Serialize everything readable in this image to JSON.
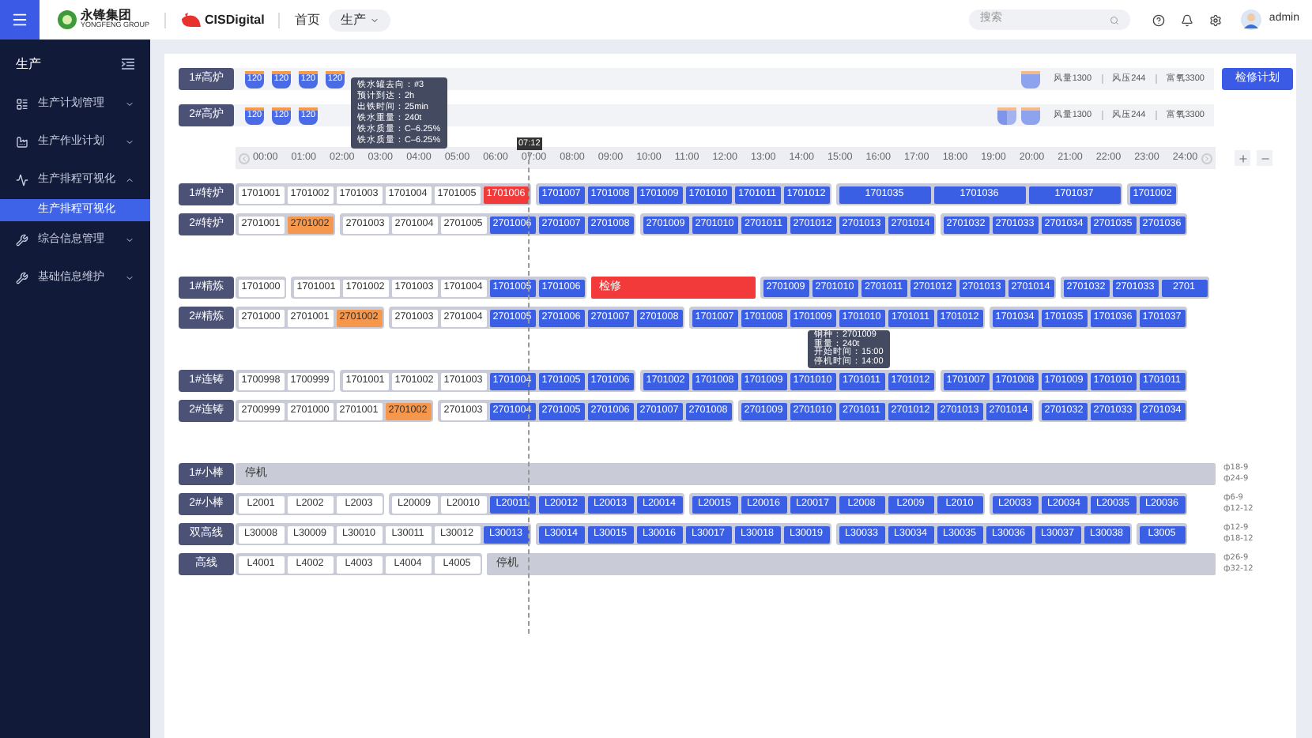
{
  "header": {
    "logo_text": "永锋集团",
    "logo_subtext": "YONGFENG GROUP",
    "brand": "CISDigital",
    "nav": [
      {
        "label": "首页",
        "kind": "link",
        "selected": false
      },
      {
        "label": "生产",
        "kind": "dropdown",
        "selected": true
      }
    ],
    "search": {
      "placeholder": "搜索"
    },
    "user": "admin"
  },
  "sidebar": {
    "title": "生产",
    "items": [
      {
        "label": "生产计划管理",
        "expanded": false
      },
      {
        "label": "生产作业计划",
        "expanded": false
      },
      {
        "label": "生产排程可视化",
        "expanded": true,
        "children": [
          {
            "label": "生产排程可视化",
            "selected": true
          }
        ]
      },
      {
        "label": "综合信息管理",
        "expanded": false
      },
      {
        "label": "基础信息维护",
        "expanded": false
      }
    ]
  },
  "furnaces": [
    {
      "label": "1#高炉",
      "ladles": [
        "120",
        "120",
        "120",
        "120"
      ],
      "spare_ladles": [
        {
          "kind": "full"
        }
      ],
      "stats": [
        "风量1300",
        "风压244",
        "富氧3300"
      ]
    },
    {
      "label": "2#高炉",
      "ladles": [
        "120",
        "120",
        "120"
      ],
      "spare_ladles": [
        {
          "kind": "half"
        },
        {
          "kind": "full"
        }
      ],
      "stats": [
        "风量1300",
        "风压244",
        "富氧3300"
      ]
    }
  ],
  "plan_button": "检修计划",
  "timeline": {
    "now": "07:12",
    "ticks": [
      "00:00",
      "01:00",
      "02:00",
      "03:00",
      "04:00",
      "05:00",
      "06:00",
      "07:00",
      "08:00",
      "09:00",
      "10:00",
      "11:00",
      "12:00",
      "13:00",
      "14:00",
      "15:00",
      "16:00",
      "17:00",
      "18:00",
      "19:00",
      "20:00",
      "21:00",
      "22:00",
      "23:00",
      "24:00"
    ]
  },
  "sections": [
    {
      "rows": [
        {
          "label": "1#转炉",
          "blocks": [
            {
              "kind": "group",
              "cells": [
                {
                  "text": "1701001",
                  "kind": "done"
                },
                {
                  "text": "1701002",
                  "kind": "done"
                },
                {
                  "text": "1701003",
                  "kind": "done"
                },
                {
                  "text": "1701004",
                  "kind": "done"
                },
                {
                  "text": "1701005",
                  "kind": "done"
                },
                {
                  "text": "1701006",
                  "kind": "alert"
                }
              ]
            },
            {
              "kind": "group",
              "cells": [
                {
                  "text": "1701007",
                  "kind": "active"
                },
                {
                  "text": "1701008",
                  "kind": "active"
                },
                {
                  "text": "1701009",
                  "kind": "active"
                },
                {
                  "text": "1701010",
                  "kind": "active"
                },
                {
                  "text": "1701011",
                  "kind": "active"
                },
                {
                  "text": "1701012",
                  "kind": "active"
                }
              ]
            },
            {
              "kind": "group",
              "cells": [
                {
                  "text": "1701035",
                  "kind": "wide"
                },
                {
                  "text": "1701036",
                  "kind": "wide"
                },
                {
                  "text": "1701037",
                  "kind": "wide"
                }
              ]
            },
            {
              "kind": "group",
              "cells": [
                {
                  "text": "1701002",
                  "kind": "active"
                }
              ]
            }
          ]
        },
        {
          "label": "2#转炉",
          "blocks": [
            {
              "kind": "group",
              "cells": [
                {
                  "text": "2701001",
                  "kind": "done"
                },
                {
                  "text": "2701002",
                  "kind": "delayed"
                }
              ]
            },
            {
              "kind": "group",
              "cells": [
                {
                  "text": "2701003",
                  "kind": "done"
                },
                {
                  "text": "2701004",
                  "kind": "done"
                },
                {
                  "text": "2701005",
                  "kind": "done"
                },
                {
                  "text": "2701006",
                  "kind": "active"
                },
                {
                  "text": "2701007",
                  "kind": "active"
                },
                {
                  "text": "2701008",
                  "kind": "active"
                }
              ]
            },
            {
              "kind": "group",
              "cells": [
                {
                  "text": "2701009",
                  "kind": "active"
                },
                {
                  "text": "2701010",
                  "kind": "active"
                },
                {
                  "text": "2701011",
                  "kind": "active"
                },
                {
                  "text": "2701012",
                  "kind": "active"
                },
                {
                  "text": "2701013",
                  "kind": "active"
                },
                {
                  "text": "2701014",
                  "kind": "active"
                }
              ]
            },
            {
              "kind": "group",
              "cells": [
                {
                  "text": "2701032",
                  "kind": "active"
                },
                {
                  "text": "2701033",
                  "kind": "active"
                },
                {
                  "text": "2701034",
                  "kind": "active"
                },
                {
                  "text": "2701035",
                  "kind": "active"
                },
                {
                  "text": "2701036",
                  "kind": "active"
                }
              ]
            }
          ]
        }
      ]
    },
    {
      "rows": [
        {
          "label": "1#精炼",
          "blocks": [
            {
              "kind": "group",
              "cells": [
                {
                  "text": "1701000",
                  "kind": "done"
                }
              ]
            },
            {
              "kind": "group",
              "cells": [
                {
                  "text": "1701001",
                  "kind": "done"
                },
                {
                  "text": "1701002",
                  "kind": "done"
                },
                {
                  "text": "1701003",
                  "kind": "done"
                },
                {
                  "text": "1701004",
                  "kind": "done"
                },
                {
                  "text": "1701005",
                  "kind": "active"
                },
                {
                  "text": "1701006",
                  "kind": "active"
                }
              ]
            },
            {
              "kind": "maintenance",
              "text": "检修"
            },
            {
              "kind": "group",
              "cells": [
                {
                  "text": "2701009",
                  "kind": "active"
                },
                {
                  "text": "2701010",
                  "kind": "active"
                },
                {
                  "text": "2701011",
                  "kind": "active"
                },
                {
                  "text": "2701012",
                  "kind": "active"
                },
                {
                  "text": "2701013",
                  "kind": "active"
                },
                {
                  "text": "2701014",
                  "kind": "active"
                }
              ]
            },
            {
              "kind": "group",
              "cells": [
                {
                  "text": "2701032",
                  "kind": "active"
                },
                {
                  "text": "2701033",
                  "kind": "active"
                },
                {
                  "text": "2701",
                  "kind": "active"
                }
              ]
            }
          ]
        },
        {
          "label": "2#精炼",
          "blocks": [
            {
              "kind": "group",
              "cells": [
                {
                  "text": "2701000",
                  "kind": "done"
                },
                {
                  "text": "2701001",
                  "kind": "done"
                },
                {
                  "text": "2701002",
                  "kind": "delayed"
                }
              ]
            },
            {
              "kind": "group",
              "cells": [
                {
                  "text": "2701003",
                  "kind": "done"
                },
                {
                  "text": "2701004",
                  "kind": "done"
                },
                {
                  "text": "2701005",
                  "kind": "active"
                },
                {
                  "text": "2701006",
                  "kind": "active"
                },
                {
                  "text": "2701007",
                  "kind": "active"
                },
                {
                  "text": "2701008",
                  "kind": "active"
                }
              ]
            },
            {
              "kind": "group",
              "cells": [
                {
                  "text": "1701007",
                  "kind": "active"
                },
                {
                  "text": "1701008",
                  "kind": "active"
                },
                {
                  "text": "1701009",
                  "kind": "active"
                },
                {
                  "text": "1701010",
                  "kind": "active"
                },
                {
                  "text": "1701011",
                  "kind": "active"
                },
                {
                  "text": "1701012",
                  "kind": "active"
                }
              ]
            },
            {
              "kind": "group",
              "cells": [
                {
                  "text": "1701034",
                  "kind": "active"
                },
                {
                  "text": "1701035",
                  "kind": "active"
                },
                {
                  "text": "1701036",
                  "kind": "active"
                },
                {
                  "text": "1701037",
                  "kind": "active"
                }
              ]
            }
          ]
        }
      ]
    },
    {
      "rows": [
        {
          "label": "1#连铸",
          "blocks": [
            {
              "kind": "group",
              "cells": [
                {
                  "text": "1700998",
                  "kind": "done"
                },
                {
                  "text": "1700999",
                  "kind": "done"
                }
              ]
            },
            {
              "kind": "group",
              "cells": [
                {
                  "text": "1701001",
                  "kind": "done"
                },
                {
                  "text": "1701002",
                  "kind": "done"
                },
                {
                  "text": "1701003",
                  "kind": "done"
                },
                {
                  "text": "1701004",
                  "kind": "active"
                },
                {
                  "text": "1701005",
                  "kind": "active"
                },
                {
                  "text": "1701006",
                  "kind": "active"
                }
              ]
            },
            {
              "kind": "group",
              "cells": [
                {
                  "text": "1701002",
                  "kind": "active"
                },
                {
                  "text": "1701008",
                  "kind": "active"
                },
                {
                  "text": "1701009",
                  "kind": "active"
                },
                {
                  "text": "1701010",
                  "kind": "active"
                },
                {
                  "text": "1701011",
                  "kind": "active"
                },
                {
                  "text": "1701012",
                  "kind": "active"
                }
              ]
            },
            {
              "kind": "group",
              "cells": [
                {
                  "text": "1701007",
                  "kind": "active"
                },
                {
                  "text": "1701008",
                  "kind": "active"
                },
                {
                  "text": "1701009",
                  "kind": "active"
                },
                {
                  "text": "1701010",
                  "kind": "active"
                },
                {
                  "text": "1701011",
                  "kind": "active"
                }
              ]
            }
          ]
        },
        {
          "label": "2#连铸",
          "blocks": [
            {
              "kind": "group",
              "cells": [
                {
                  "text": "2700999",
                  "kind": "done"
                },
                {
                  "text": "2701000",
                  "kind": "done"
                },
                {
                  "text": "2701001",
                  "kind": "done"
                },
                {
                  "text": "2701002",
                  "kind": "delayed"
                }
              ]
            },
            {
              "kind": "group",
              "cells": [
                {
                  "text": "2701003",
                  "kind": "done"
                },
                {
                  "text": "2701004",
                  "kind": "active"
                },
                {
                  "text": "2701005",
                  "kind": "active"
                },
                {
                  "text": "2701006",
                  "kind": "active"
                },
                {
                  "text": "2701007",
                  "kind": "active"
                },
                {
                  "text": "2701008",
                  "kind": "active"
                }
              ]
            },
            {
              "kind": "group",
              "cells": [
                {
                  "text": "2701009",
                  "kind": "active"
                },
                {
                  "text": "2701010",
                  "kind": "active"
                },
                {
                  "text": "2701011",
                  "kind": "active"
                },
                {
                  "text": "2701012",
                  "kind": "active"
                },
                {
                  "text": "2701013",
                  "kind": "active"
                },
                {
                  "text": "2701014",
                  "kind": "active"
                }
              ]
            },
            {
              "kind": "group",
              "cells": [
                {
                  "text": "2701032",
                  "kind": "active"
                },
                {
                  "text": "2701033",
                  "kind": "active"
                },
                {
                  "text": "2701034",
                  "kind": "active"
                }
              ]
            }
          ]
        }
      ]
    },
    {
      "rows": [
        {
          "label": "1#小棒",
          "specs": [
            "ф18-9",
            "ф24-9"
          ],
          "blocks": [
            {
              "kind": "idle",
              "text": "停机"
            }
          ]
        },
        {
          "label": "2#小棒",
          "specs": [
            "ф6-9",
            "ф12-12"
          ],
          "blocks": [
            {
              "kind": "group",
              "cells": [
                {
                  "text": "L2001",
                  "kind": "done"
                },
                {
                  "text": "L2002",
                  "kind": "done"
                },
                {
                  "text": "L2003",
                  "kind": "done"
                }
              ]
            },
            {
              "kind": "group",
              "cells": [
                {
                  "text": "L20009",
                  "kind": "done"
                },
                {
                  "text": "L20010",
                  "kind": "done"
                },
                {
                  "text": "L20011",
                  "kind": "active"
                },
                {
                  "text": "L20012",
                  "kind": "active"
                },
                {
                  "text": "L20013",
                  "kind": "active"
                },
                {
                  "text": "L20014",
                  "kind": "active"
                }
              ]
            },
            {
              "kind": "group",
              "cells": [
                {
                  "text": "L20015",
                  "kind": "active"
                },
                {
                  "text": "L20016",
                  "kind": "active"
                },
                {
                  "text": "L20017",
                  "kind": "active"
                },
                {
                  "text": "L2008",
                  "kind": "active"
                },
                {
                  "text": "L2009",
                  "kind": "active"
                },
                {
                  "text": "L2010",
                  "kind": "active"
                }
              ]
            },
            {
              "kind": "group",
              "cells": [
                {
                  "text": "L20033",
                  "kind": "active"
                },
                {
                  "text": "L20034",
                  "kind": "active"
                },
                {
                  "text": "L20035",
                  "kind": "active"
                },
                {
                  "text": "L20036",
                  "kind": "active"
                }
              ]
            }
          ]
        },
        {
          "label": "双高线",
          "specs": [
            "ф12-9",
            "ф18-12"
          ],
          "blocks": [
            {
              "kind": "group",
              "cells": [
                {
                  "text": "L30008",
                  "kind": "done"
                },
                {
                  "text": "L30009",
                  "kind": "done"
                },
                {
                  "text": "L30010",
                  "kind": "done"
                },
                {
                  "text": "L30011",
                  "kind": "done"
                },
                {
                  "text": "L30012",
                  "kind": "done"
                },
                {
                  "text": "L30013",
                  "kind": "active"
                }
              ]
            },
            {
              "kind": "group",
              "cells": [
                {
                  "text": "L30014",
                  "kind": "active"
                },
                {
                  "text": "L30015",
                  "kind": "active"
                },
                {
                  "text": "L30016",
                  "kind": "active"
                },
                {
                  "text": "L30017",
                  "kind": "active"
                },
                {
                  "text": "L30018",
                  "kind": "active"
                },
                {
                  "text": "L30019",
                  "kind": "active"
                }
              ]
            },
            {
              "kind": "group",
              "cells": [
                {
                  "text": "L30033",
                  "kind": "active"
                },
                {
                  "text": "L30034",
                  "kind": "active"
                },
                {
                  "text": "L30035",
                  "kind": "active"
                },
                {
                  "text": "L30036",
                  "kind": "active"
                },
                {
                  "text": "L30037",
                  "kind": "active"
                },
                {
                  "text": "L30038",
                  "kind": "active"
                }
              ]
            },
            {
              "kind": "group",
              "cells": [
                {
                  "text": "L3005",
                  "kind": "active"
                }
              ]
            }
          ]
        },
        {
          "label": "高线",
          "specs": [
            "ф26-9",
            "ф32-12"
          ],
          "blocks": [
            {
              "kind": "group",
              "cells": [
                {
                  "text": "L4001",
                  "kind": "done"
                },
                {
                  "text": "L4002",
                  "kind": "done"
                },
                {
                  "text": "L4003",
                  "kind": "done"
                },
                {
                  "text": "L4004",
                  "kind": "done"
                },
                {
                  "text": "L4005",
                  "kind": "done"
                }
              ]
            },
            {
              "kind": "idle",
              "text": "停机"
            }
          ]
        }
      ]
    }
  ],
  "tooltips": [
    {
      "lines": [
        "铁水罐去向：#3",
        "预计到达：2h",
        "出铁时间：25min",
        "铁水重量：240t",
        "铁水质量：C–6.25%",
        "铁水质量：C–6.25%"
      ]
    },
    {
      "lines": [
        "钢种：2701009",
        "重量：240t",
        "开始时间：15:00",
        "停机时间：14:00"
      ]
    }
  ]
}
